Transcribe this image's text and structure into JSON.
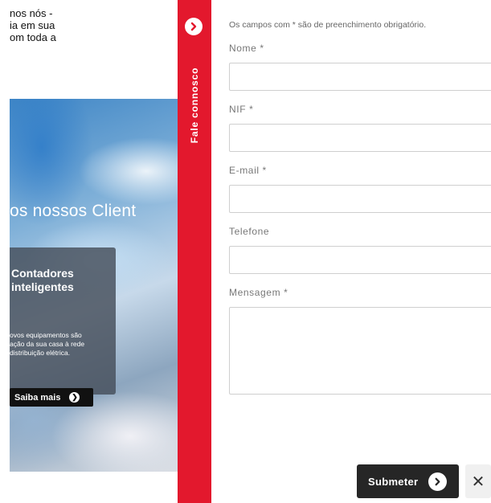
{
  "background_page": {
    "intro_lines": [
      "nos nós -",
      "ia em sua",
      "om toda a"
    ],
    "hero_title": "os nossos Client",
    "card": {
      "title_lines": [
        "Contadores",
        "inteligentes"
      ],
      "text_lines": [
        "ovos equipamentos são",
        "ação da sua casa à rede",
        "distribuição elétrica."
      ],
      "button_label": "Saiba mais",
      "button_icon": "chevron-right-circle-icon"
    }
  },
  "side_tab": {
    "label": "Fale connosco",
    "toggle_icon": "chevron-right-circle-icon",
    "color": "#e3182d"
  },
  "form": {
    "required_note": "Os campos com * são de preenchimento obrigatório.",
    "fields": [
      {
        "label": "Nome *",
        "value": "",
        "type": "text"
      },
      {
        "label": "NIF *",
        "value": "",
        "type": "text"
      },
      {
        "label": "E-mail *",
        "value": "",
        "type": "email"
      },
      {
        "label": "Telefone",
        "value": "",
        "type": "tel"
      },
      {
        "label": "Mensagem *",
        "value": "",
        "type": "textarea"
      }
    ],
    "submit_label": "Submeter",
    "submit_icon": "chevron-right-circle-icon",
    "close_icon": "close-icon",
    "close_glyph": "✕"
  }
}
